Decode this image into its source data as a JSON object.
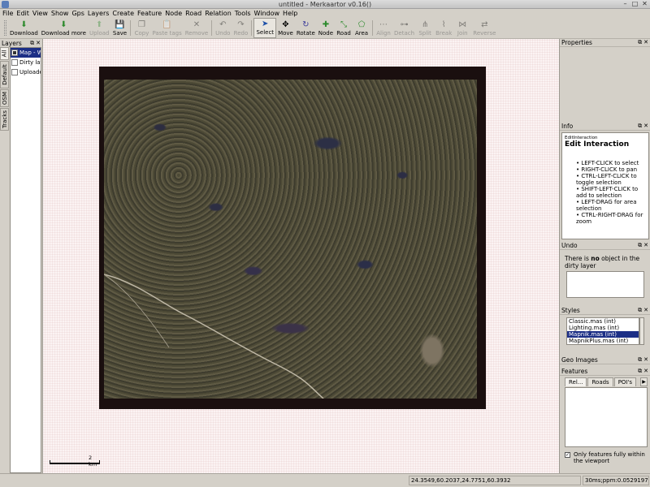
{
  "window": {
    "title": "untitled - Merkaartor v0.16()"
  },
  "menus": [
    "File",
    "Edit",
    "View",
    "Show",
    "Gps",
    "Layers",
    "Create",
    "Feature",
    "Node",
    "Road",
    "Relation",
    "Tools",
    "Window",
    "Help"
  ],
  "toolbar": {
    "download": "Download",
    "download_more": "Download more",
    "upload": "Upload",
    "save": "Save",
    "copy": "Copy",
    "paste_tags": "Paste tags",
    "remove": "Remove",
    "undo": "Undo",
    "redo": "Redo",
    "select": "Select",
    "move": "Move",
    "rotate": "Rotate",
    "node": "Node",
    "road": "Road",
    "area": "Area",
    "align": "Align",
    "detach": "Detach",
    "split": "Split",
    "break": "Break",
    "join": "Join",
    "reverse": "Reverse"
  },
  "layers_panel": {
    "title": "Layers",
    "tabs": [
      "All",
      "Default",
      "OSM",
      "Tracks"
    ],
    "items": [
      "Map - W",
      "Dirty lay",
      "Uploade"
    ]
  },
  "map": {
    "scale_label": "2 km"
  },
  "properties": {
    "title": "Properties"
  },
  "info": {
    "title": "Info",
    "small_label": "EditInteraction",
    "heading": "Edit Interaction",
    "bullets": [
      "LEFT-CLICK to select",
      "RIGHT-CLICK to pan",
      "CTRL-LEFT-CLICK to toggle selection",
      "SHIFT-LEFT-CLICK to add to selection",
      "LEFT-DRAG for area selection",
      "CTRL-RIGHT-DRAG for zoom"
    ]
  },
  "undo": {
    "title": "Undo",
    "text_before": "There is ",
    "text_bold": "no",
    "text_after": " object in the dirty layer"
  },
  "styles": {
    "title": "Styles",
    "items": [
      "Classic.mas (int)",
      "Lighting.mas (int)",
      "Mapnik.mas (int)",
      "MapnikPlus.mas (int)"
    ]
  },
  "geo_images": {
    "title": "Geo Images"
  },
  "features": {
    "title": "Features",
    "tabs": [
      "Rel...",
      "Roads",
      "POI's"
    ],
    "checkbox_label": "Only features fully within the viewport"
  },
  "status": {
    "coords": "24.3549,60.2037,24.7751,60.3932",
    "scale": "30ms;ppm:0.0529197"
  }
}
